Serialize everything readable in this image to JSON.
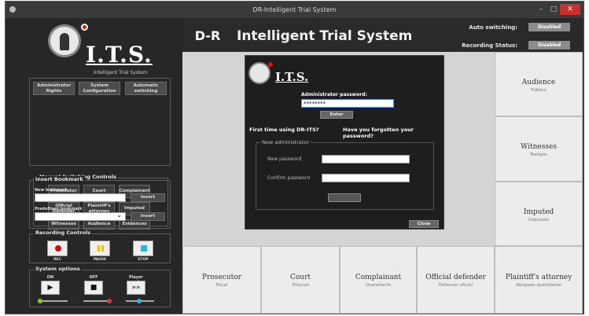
{
  "window": {
    "title": "DR-Intelligent Trial System",
    "min_glyph": "–",
    "max_glyph": "□",
    "close_glyph": "✕"
  },
  "logo": {
    "text": "I.T.S.",
    "subtitle": "Intelligent Trial System"
  },
  "header": {
    "brand": "D-R",
    "title": "Intelligent Trial System",
    "auto_switching_label": "Auto switching:",
    "auto_switching_value": "Disabled",
    "recording_status_label": "Recording Status:",
    "recording_status_value": "Disabled"
  },
  "top_buttons": [
    "Administrator Rights",
    "System Configuration",
    "Automatic switching"
  ],
  "manual_switching": {
    "legend": "Manual Switching Controls",
    "buttons": [
      [
        "Prosecutor",
        "Court",
        "Complainant"
      ],
      [
        "Official Defender",
        "Plaintiff's attorney",
        "Imputed"
      ],
      [
        "Witnesses",
        "Audience",
        "Evidences"
      ]
    ]
  },
  "bookmark": {
    "legend": "Insert Bookmark",
    "new_label": "New bookmark",
    "new_value": "",
    "predefined_label": "Predefined bookmark",
    "predefined_value": "",
    "insert_label": "Insert",
    "dropdown_glyph": "⌄"
  },
  "recording": {
    "legend": "Recording Controls",
    "buttons": [
      {
        "label": "REC",
        "color": "#e00000"
      },
      {
        "label": "PAUSE",
        "color": "#f0c000"
      },
      {
        "label": "STOP",
        "color": "#29b6e6"
      }
    ]
  },
  "system_options": {
    "legend": "System options",
    "on_label": "ON",
    "off_label": "OFF",
    "player_label": "Player mode",
    "on_glyph": "▶",
    "off_glyph": "■",
    "player_glyph": "»»",
    "knob_colors": [
      "#7ed321",
      "#e03a3a",
      "#29b6e6"
    ]
  },
  "dialog": {
    "logo_text": "I.T.S.",
    "password_label": "Administrator password:",
    "password_value": "********",
    "enter_label": "Enter",
    "first_time_link": "First time using DR-ITS?",
    "forgot_link": "Have you forgotten your password?",
    "new_admin_legend": "New administrator",
    "new_password_label": "New password",
    "confirm_password_label": "Confirm password",
    "save_label": "Save",
    "close_label": "Close"
  },
  "right_parties": [
    {
      "en": "Audience",
      "es": "Público"
    },
    {
      "en": "Witnesses",
      "es": "Testigos"
    },
    {
      "en": "Imputed",
      "es": "Imputado"
    }
  ],
  "bottom_parties": [
    {
      "en": "Prosecutor",
      "es": "Fiscal"
    },
    {
      "en": "Court",
      "es": "Tribunal"
    },
    {
      "en": "Complainant",
      "es": "Querellante"
    },
    {
      "en": "Official defender",
      "es": "Defensor oficial"
    },
    {
      "en": "Plaintiff's attorney",
      "es": "Abogado querellante"
    }
  ]
}
